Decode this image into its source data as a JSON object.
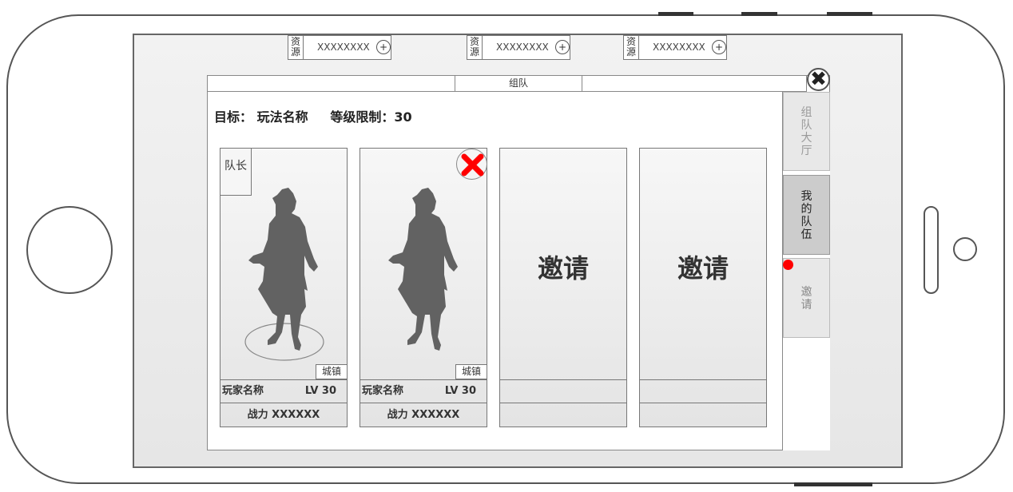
{
  "resources": [
    {
      "icon_label": "资源",
      "value": "XXXXXXXX",
      "plus": "+"
    },
    {
      "icon_label": "资源",
      "value": "XXXXXXXX",
      "plus": "+"
    },
    {
      "icon_label": "资源",
      "value": "XXXXXXXX",
      "plus": "+"
    }
  ],
  "dialog": {
    "title": "组队",
    "close_icon": "✖",
    "target_text": "目标： 玩法名称     等级限制：30"
  },
  "members": [
    {
      "role": "队长",
      "location": "城镇",
      "name": "玩家名称",
      "level": "LV 30",
      "power": "战力 XXXXXX"
    },
    {
      "location": "城镇",
      "name": "玩家名称",
      "level": "LV 30",
      "power": "战力 XXXXXX"
    }
  ],
  "invite_slots": [
    {
      "label": "邀请"
    },
    {
      "label": "邀请"
    }
  ],
  "side_tabs": [
    {
      "label": "组\n队\n大\n厅",
      "active": false
    },
    {
      "label": "我\n的\n队\n伍",
      "active": true
    },
    {
      "label": "邀\n请",
      "active": false,
      "badge_color": "#ff0000"
    }
  ],
  "colors": {
    "kick_red": "#ff0000",
    "silhouette": "#626262"
  }
}
